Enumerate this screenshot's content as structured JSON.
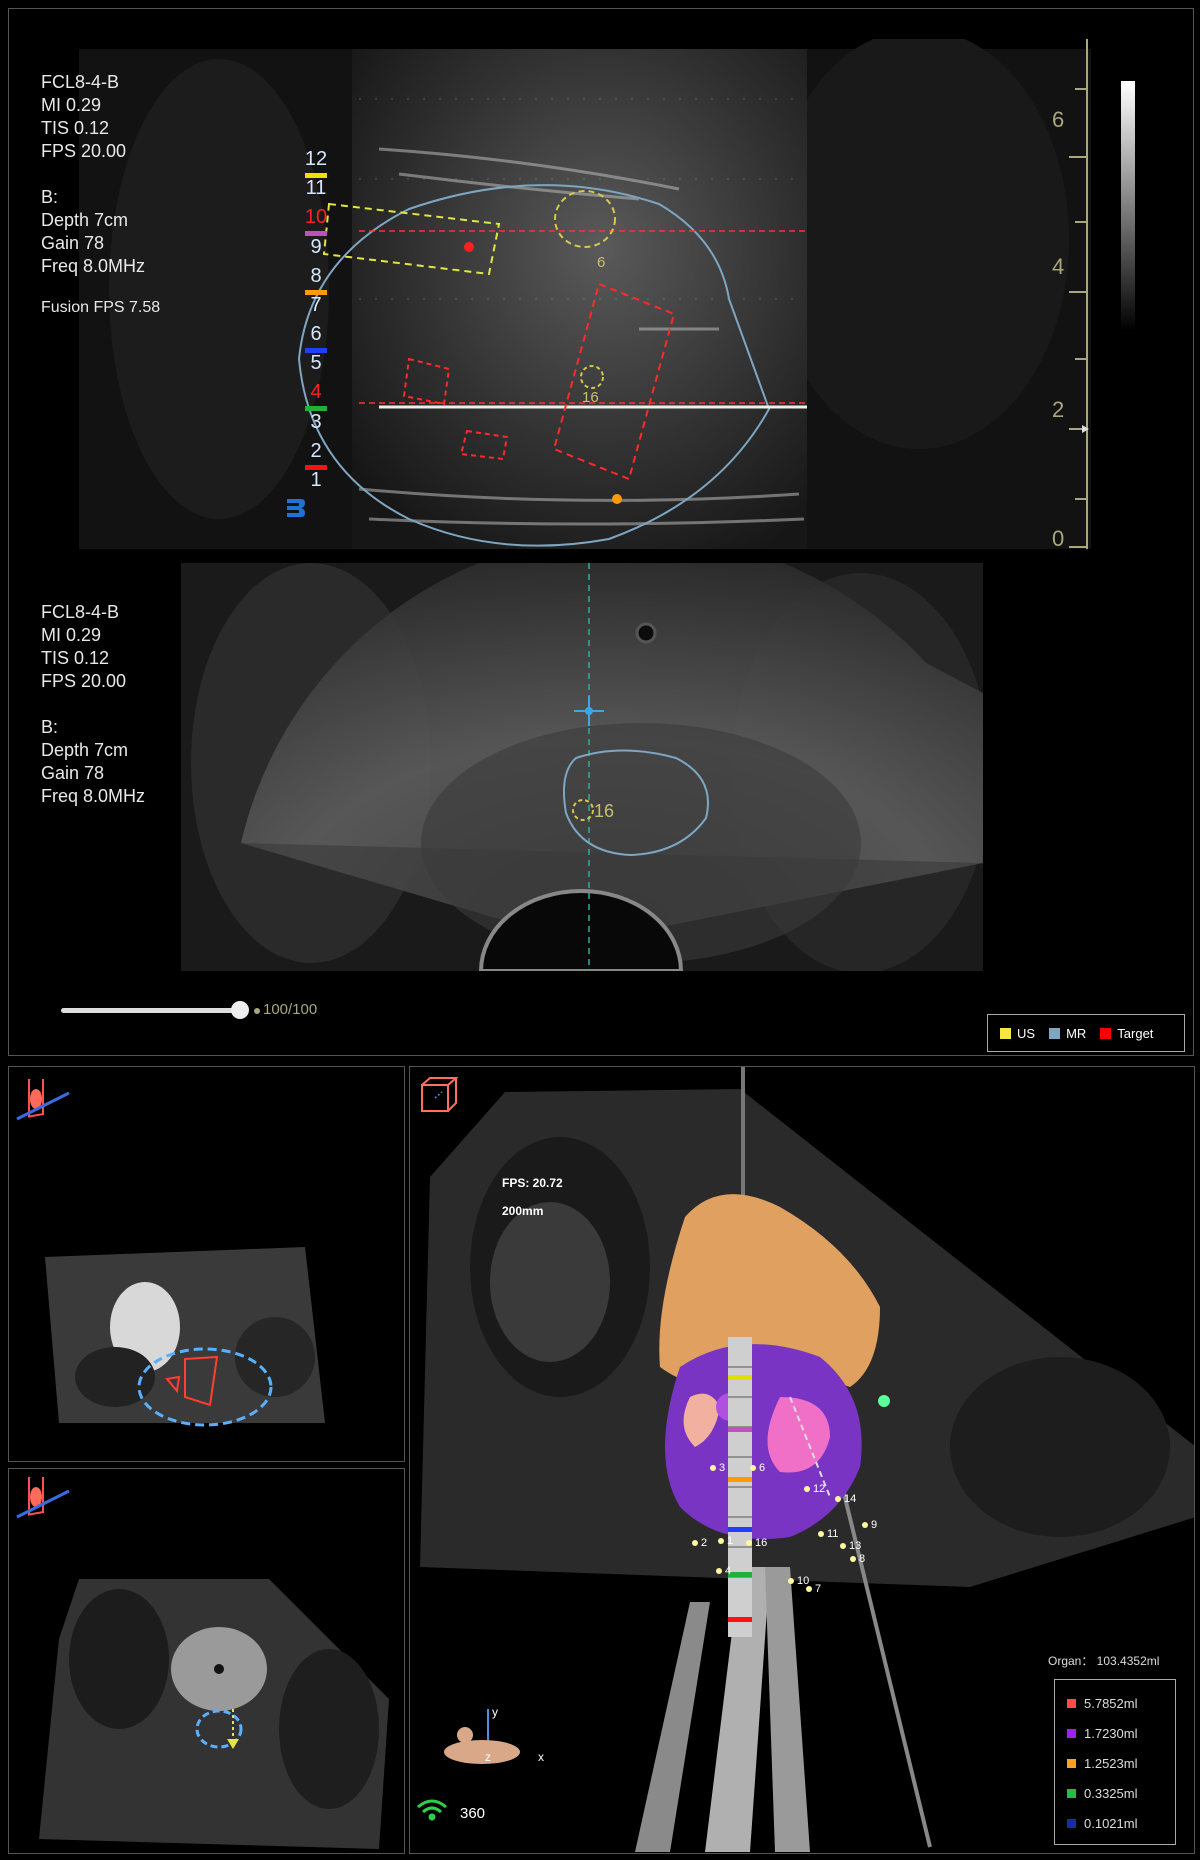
{
  "top_panel": {
    "info_lines": [
      "FCL8-4-B",
      "MI 0.29",
      "TIS 0.12",
      "FPS 20.00",
      "",
      "B:",
      "Depth 7cm",
      "Gain 78",
      "Freq 8.0MHz"
    ],
    "fusion_fps": "Fusion FPS 7.58",
    "ruler_labels": [
      "6",
      "4",
      "2",
      "0"
    ],
    "target_labels": {
      "upper": "6",
      "lower": "16"
    },
    "needle_positions": [
      {
        "label": "12",
        "color": "#d7e7ff",
        "bar": "#f0e000"
      },
      {
        "label": "11",
        "color": "#d7e7ff",
        "bar": null
      },
      {
        "label": "10",
        "color": "#ff2020",
        "bar": "#c050c0"
      },
      {
        "label": "9",
        "color": "#d7e7ff",
        "bar": null
      },
      {
        "label": "8",
        "color": "#d7e7ff",
        "bar": "#ff9a00"
      },
      {
        "label": "7",
        "color": "#d7e7ff",
        "bar": null
      },
      {
        "label": "6",
        "color": "#d7e7ff",
        "bar": "#2040ff"
      },
      {
        "label": "5",
        "color": "#d7e7ff",
        "bar": null
      },
      {
        "label": "4",
        "color": "#ff2020",
        "bar": "#20b040"
      },
      {
        "label": "3",
        "color": "#d7e7ff",
        "bar": null
      },
      {
        "label": "2",
        "color": "#d7e7ff",
        "bar": "#ff1010"
      },
      {
        "label": "1",
        "color": "#d7e7ff",
        "bar": null
      }
    ]
  },
  "middle_panel": {
    "info_lines": [
      "FCL8-4-B",
      "MI 0.29",
      "TIS 0.12",
      "FPS 20.00",
      "",
      "B:",
      "Depth 7cm",
      "Gain 78",
      "Freq 8.0MHz"
    ],
    "target_label": "16",
    "slider": {
      "label": "100/100",
      "value": 100,
      "max": 100
    },
    "legend": [
      {
        "label": "US",
        "color": "#f5e642"
      },
      {
        "label": "MR",
        "color": "#7ea6c2"
      },
      {
        "label": "Target",
        "color": "#ff0000"
      }
    ]
  },
  "view3d": {
    "fps": "FPS: 20.72",
    "scale": "200mm",
    "organ": "Organ： 103.4352ml",
    "volumes": [
      {
        "label": "5.7852ml",
        "color": "#ff4a4a"
      },
      {
        "label": "1.7230ml",
        "color": "#a020f0"
      },
      {
        "label": "1.2523ml",
        "color": "#ffa020"
      },
      {
        "label": "0.3325ml",
        "color": "#20c040"
      },
      {
        "label": "0.1021ml",
        "color": "#1a2ab0"
      }
    ],
    "points": [
      "3",
      "6",
      "12",
      "14",
      "9",
      "11",
      "13",
      "8",
      "10",
      "7",
      "4",
      "1",
      "16",
      "2"
    ],
    "axis": {
      "y": "y",
      "z": "z",
      "x": "x"
    },
    "rotation": "360"
  },
  "colors": {
    "us_outline": "#f5e642",
    "mr_outline": "#7ea6c2",
    "target": "#ff2a2a",
    "ruler": "#a9a77d"
  }
}
